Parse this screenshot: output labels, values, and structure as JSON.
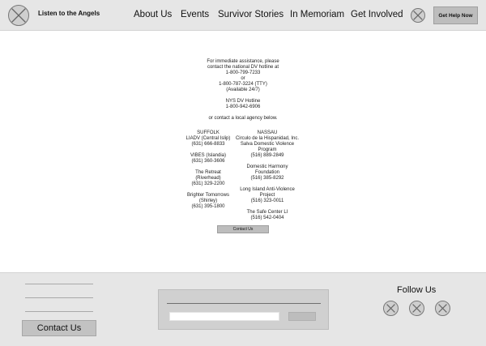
{
  "header": {
    "brand": "Listen to the Angels",
    "nav": [
      "About Us",
      "Events",
      "Survivor Stories",
      "In Memoriam",
      "Get Involved"
    ],
    "cta_label": "Get Help Now"
  },
  "main": {
    "intro_lines": [
      "For immediate assistance, please",
      "contact the national DV hotline at",
      "1-800-799-7233",
      "or",
      "1-800-787-3224 (TTY)",
      "(Available 24/7)"
    ],
    "nys_lines": [
      "NYS DV Hotline",
      "1-800-942-6906"
    ],
    "local_note": "or contact a local agency below.",
    "suffolk": {
      "heading": "SUFFOLK",
      "agencies": [
        {
          "lines": [
            "LIADV (Central Islip)",
            "(631) 666-8833"
          ]
        },
        {
          "lines": [
            "VIBES (Islandia)",
            "(631) 360-3606"
          ]
        },
        {
          "lines": [
            "The Retreat",
            "(Riverhead)",
            "(631) 329-2200"
          ]
        },
        {
          "lines": [
            "Brighter Tomorrows",
            "(Shirley)",
            "(631) 395-1800"
          ]
        }
      ]
    },
    "nassau": {
      "heading": "NASSAU",
      "agencies": [
        {
          "lines": [
            "Circulo de la Hispanidad, Inc.",
            "Salva Domestic Violence",
            "Program",
            "(516) 889-2849"
          ]
        },
        {
          "lines": [
            "Domestic Harmony",
            "Foundation",
            "(516) 385-8292"
          ]
        },
        {
          "lines": [
            "Long Island Anti-Violence",
            "Project",
            "(516) 323-0011"
          ]
        },
        {
          "lines": [
            "The Safe Center LI",
            "(516) 542-0404"
          ]
        }
      ]
    },
    "contact_button": "Contact Us"
  },
  "footer": {
    "contact_button": "Contact Us",
    "follow_label": "Follow Us"
  }
}
